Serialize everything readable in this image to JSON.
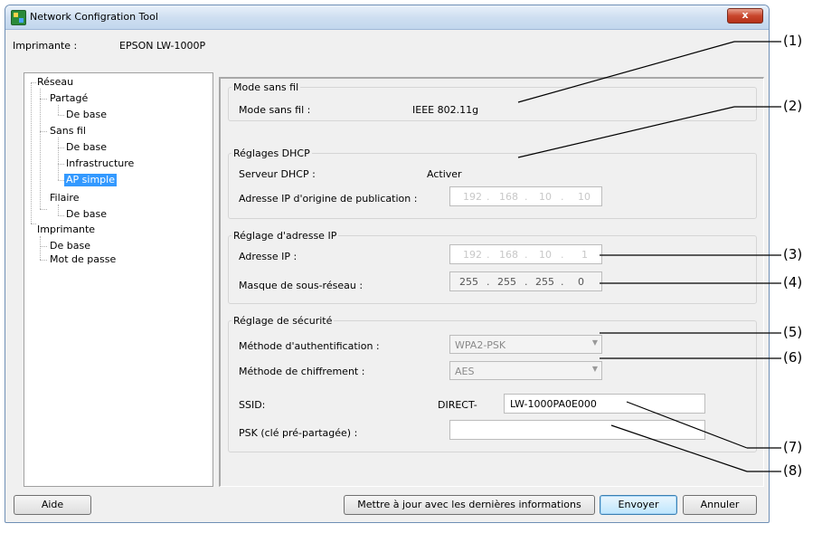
{
  "window": {
    "title": "Network Configration Tool",
    "close_label": "x"
  },
  "printer": {
    "label": "Imprimante :",
    "name": "EPSON LW-1000P"
  },
  "tree": {
    "reseau": "Réseau",
    "partage": "Partagé",
    "partage_debase": "De base",
    "sansfil": "Sans fil",
    "sansfil_debase": "De base",
    "infrastructure": "Infrastructure",
    "apsimple": "AP simple",
    "filaire": "Filaire",
    "filaire_debase": "De base",
    "imprimante": "Imprimante",
    "imprimante_debase": "De base",
    "motdepasse": "Mot de passe"
  },
  "wireless": {
    "group_title": "Mode sans fil",
    "mode_label": "Mode sans fil :",
    "mode_value": "IEEE 802.11g"
  },
  "dhcp": {
    "group_title": "Réglages DHCP",
    "server_label": "Serveur DHCP :",
    "server_value": "Activer",
    "start_ip_label": "Adresse IP d'origine de publication :",
    "start_ip": [
      "192",
      "168",
      "10",
      "10"
    ]
  },
  "ip": {
    "group_title": "Réglage d'adresse IP",
    "address_label": "Adresse IP :",
    "address": [
      "192",
      "168",
      "10",
      "1"
    ],
    "subnet_label": "Masque de sous-réseau :",
    "subnet": [
      "255",
      "255",
      "255",
      "0"
    ]
  },
  "security": {
    "group_title": "Réglage de sécurité",
    "auth_label": "Méthode d'authentification :",
    "auth_value": "WPA2-PSK",
    "enc_label": "Méthode de chiffrement :",
    "enc_value": "AES",
    "ssid_label": "SSID:",
    "ssid_prefix": "DIRECT-",
    "ssid_value": "LW-1000PA0E000",
    "psk_label": "PSK (clé pré-partagée) :",
    "psk_value": ""
  },
  "buttons": {
    "help": "Aide",
    "update": "Mettre à jour avec les dernières informations",
    "send": "Envoyer",
    "cancel": "Annuler"
  },
  "callouts": [
    "(1)",
    "(2)",
    "(3)",
    "(4)",
    "(5)",
    "(6)",
    "(7)",
    "(8)"
  ]
}
